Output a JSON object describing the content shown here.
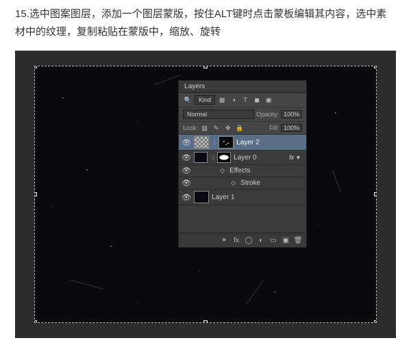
{
  "article": {
    "step_text": "15.选中图案图层，添加一个图层蒙版，按住ALT键时点击蒙板编辑其内容，选中素材中的纹理，复制粘贴在蒙版中，缩放、旋转"
  },
  "panel": {
    "title": "Layers",
    "filter_label": "Kind",
    "blend_mode": "Normal",
    "opacity_label": "Opacity:",
    "opacity_value": "100%",
    "lock_label": "Lock:",
    "fill_label": "Fill:",
    "fill_value": "100%"
  },
  "layers": {
    "layer2": "Layer 2",
    "layer0": "Layer 0",
    "effects": "Effects",
    "stroke": "Stroke",
    "layer1": "Layer 1"
  }
}
